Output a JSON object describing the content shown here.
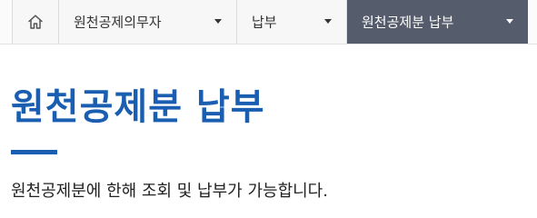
{
  "breadcrumb": {
    "home_icon": "home-icon",
    "items": [
      {
        "label": "원천공제의무자",
        "icon": "caret-down-icon"
      },
      {
        "label": "납부",
        "icon": "caret-down-icon"
      },
      {
        "label": "원천공제분 납부",
        "icon": "caret-down-icon",
        "active": true
      }
    ]
  },
  "main": {
    "title": "원천공제분 납부",
    "description": "원천공제분에 한해 조회 및 납부가 가능합니다."
  },
  "colors": {
    "accent": "#1a5eb1",
    "active_crumb_bg": "#555c6b",
    "breadcrumb_bg": "#f7f7f7"
  }
}
